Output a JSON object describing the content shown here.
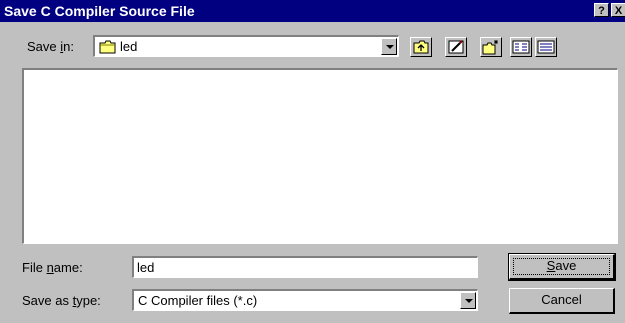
{
  "window": {
    "title": "Save C Compiler Source File",
    "help_glyph": "?",
    "close_glyph": "X"
  },
  "save_in": {
    "label_pre": "Save ",
    "label_mnemonic": "i",
    "label_post": "n:",
    "folder_icon": "folder-icon",
    "value": "led"
  },
  "toolbar": {
    "icons": [
      "up-one-level-icon",
      "desktop-icon",
      "new-folder-icon",
      "list-view-icon",
      "details-view-icon"
    ]
  },
  "file_list": {
    "items": []
  },
  "file_name": {
    "label_pre": "File ",
    "label_mnemonic": "n",
    "label_post": "ame:",
    "value": "led"
  },
  "save_as_type": {
    "label_pre": "Save as ",
    "label_mnemonic": "t",
    "label_post": "ype:",
    "value": "C Compiler files (*.c)"
  },
  "buttons": {
    "save_mnemonic": "S",
    "save_rest": "ave",
    "cancel": "Cancel"
  },
  "colors": {
    "titlebar": "#000080",
    "face": "#c0c0c0",
    "folder": "#ffff80"
  }
}
